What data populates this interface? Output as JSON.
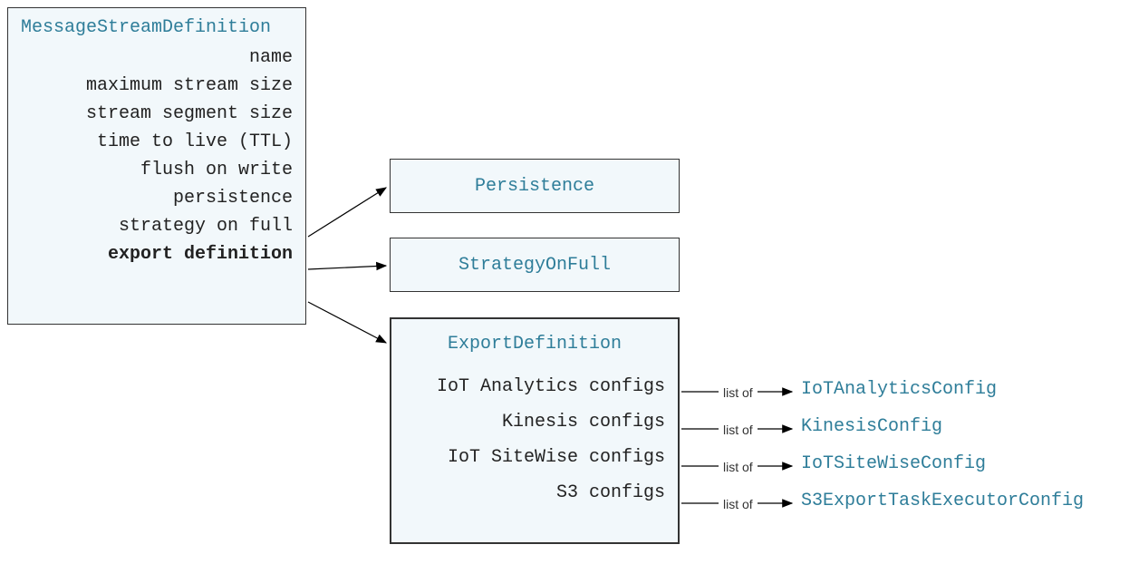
{
  "msd": {
    "title": "MessageStreamDefinition",
    "props": {
      "name": "name",
      "max_size": "maximum stream size",
      "seg_size": "stream segment size",
      "ttl": "time to live (TTL)",
      "flush": "flush on write",
      "persistence": "persistence",
      "strategy": "strategy on full",
      "export_def": "export definition"
    }
  },
  "persistence_box": "Persistence",
  "strategy_box": "StrategyOnFull",
  "export_def": {
    "title": "ExportDefinition",
    "iot_analytics": "IoT Analytics configs",
    "kinesis": "Kinesis configs",
    "sitewise": "IoT SiteWise configs",
    "s3": "S3 configs"
  },
  "listof": "list of",
  "config_types": {
    "iot_analytics": "IoTAnalyticsConfig",
    "kinesis": "KinesisConfig",
    "sitewise": "IoTSiteWiseConfig",
    "s3": "S3ExportTaskExecutorConfig"
  }
}
